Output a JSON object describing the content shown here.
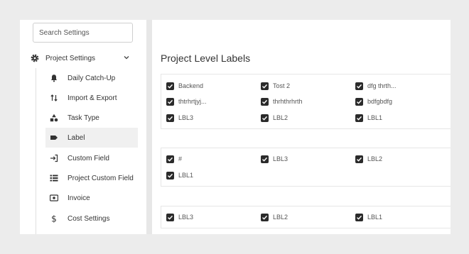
{
  "sidebar": {
    "search": {
      "placeholder": "Search Settings"
    },
    "group": {
      "label": "Project Settings"
    },
    "items": [
      {
        "label": "Daily Catch-Up",
        "icon": "bell-icon"
      },
      {
        "label": "Import & Export",
        "icon": "arrows-swap-icon"
      },
      {
        "label": "Task Type",
        "icon": "shapes-icon"
      },
      {
        "label": "Label",
        "icon": "tag-icon",
        "active": true
      },
      {
        "label": "Custom Field",
        "icon": "field-enter-icon"
      },
      {
        "label": "Project Custom Field",
        "icon": "list-icon"
      },
      {
        "label": "Invoice",
        "icon": "invoice-icon"
      },
      {
        "label": "Cost Settings",
        "icon": "dollar-icon"
      }
    ]
  },
  "main": {
    "title": "Project Level Labels",
    "cards": [
      {
        "labels": [
          "Backend",
          "Tost 2",
          "dfg thrth...",
          "thtrhrtjyj...",
          "thrhthrhrth",
          "bdfgbdfg",
          "LBL3",
          "LBL2",
          "LBL1"
        ]
      },
      {
        "labels": [
          "#",
          "LBL3",
          "LBL2",
          "LBL1"
        ]
      },
      {
        "labels": [
          "LBL3",
          "LBL2",
          "LBL1"
        ]
      }
    ]
  },
  "colors": {
    "checkbox": "#2b2b2b",
    "active_item_bg": "#f0f0f0",
    "background": "#ececec"
  }
}
